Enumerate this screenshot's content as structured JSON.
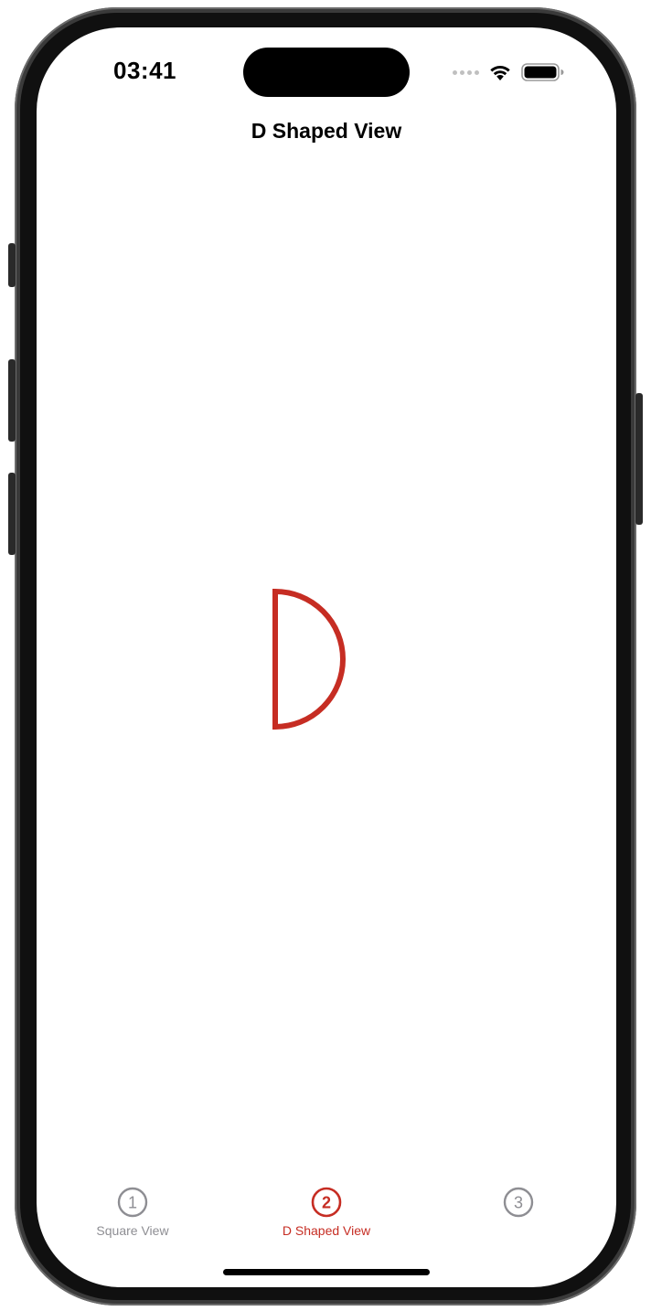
{
  "status_bar": {
    "time": "03:41",
    "wifi_icon": "wifi-icon",
    "battery_icon": "battery-icon"
  },
  "nav": {
    "title": "D Shaped View"
  },
  "shape": {
    "type": "d-shape",
    "stroke_color": "#c62d23"
  },
  "tabs": [
    {
      "number": "1",
      "label": "Square View",
      "active": false
    },
    {
      "number": "2",
      "label": "D Shaped View",
      "active": true
    },
    {
      "number": "3",
      "label": "",
      "active": false
    }
  ],
  "colors": {
    "accent": "#c62d23",
    "inactive": "#8e8e93"
  }
}
